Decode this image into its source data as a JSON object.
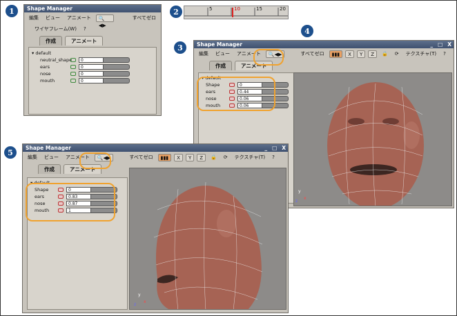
{
  "steps": [
    "1",
    "2",
    "3",
    "4",
    "5"
  ],
  "title": "Shape Manager",
  "menu": {
    "edit": "編集",
    "view": "ビュー",
    "anim": "アニメート",
    "reset_all": "すべてゼロ",
    "wireframe": "ワイヤフレーム(W)",
    "texture": "テクスチャ(T)",
    "help": "?"
  },
  "window_buttons": {
    "min": "_",
    "max": "□",
    "close": "X"
  },
  "axis_buttons": [
    "X",
    "Y",
    "Z"
  ],
  "tabs": {
    "create": "作成",
    "animate": "アニメート"
  },
  "group_label": "default",
  "ruler_ticks": [
    "5",
    "10",
    "15",
    "20"
  ],
  "panel1": {
    "shapes": [
      {
        "name": "neutral_shape",
        "value": "0"
      },
      {
        "name": "ears",
        "value": "0"
      },
      {
        "name": "nose",
        "value": "0"
      },
      {
        "name": "mouth",
        "value": "0"
      }
    ]
  },
  "panel3": {
    "shapes": [
      {
        "name": "Shape",
        "value": "0"
      },
      {
        "name": "ears",
        "value": "0.44"
      },
      {
        "name": "nose",
        "value": "0.06"
      },
      {
        "name": "mouth",
        "value": "0.06"
      }
    ]
  },
  "panel5": {
    "shapes": [
      {
        "name": "Shape",
        "value": "0"
      },
      {
        "name": "ears",
        "value": "0.83"
      },
      {
        "name": "nose",
        "value": "0.87"
      },
      {
        "name": "mouth",
        "value": "1"
      }
    ]
  },
  "axes_labels": {
    "x": "x",
    "y": "y",
    "z": "z"
  },
  "colors": {
    "title": "#3f5170",
    "highlight": "#f0a22e",
    "step": "#1d4f8c",
    "panel": "#c8c4bc"
  }
}
